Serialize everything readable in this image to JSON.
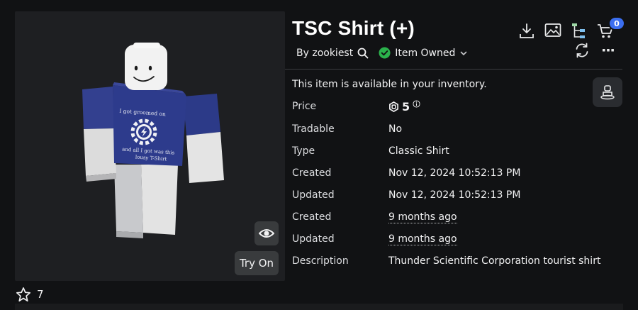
{
  "item": {
    "title": "TSC Shirt (+)",
    "creator": "By zookiest",
    "owned_label": "Item Owned",
    "availability": "This item is available in your inventory."
  },
  "shirt_print": {
    "line1": "I got groomed on",
    "line2": "and all I got was this",
    "line3": "lousy T-Shirt"
  },
  "preview": {
    "try_on_label": "Try On"
  },
  "favorites": {
    "count": "7"
  },
  "header_actions": {
    "cart_count": "0"
  },
  "details": {
    "price": {
      "label": "Price",
      "value": "5"
    },
    "tradable": {
      "label": "Tradable",
      "value": "No"
    },
    "type": {
      "label": "Type",
      "value": "Classic Shirt"
    },
    "created": {
      "label": "Created",
      "value": "Nov 12, 2024 10:52:13 PM"
    },
    "updated": {
      "label": "Updated",
      "value": "Nov 12, 2024 10:52:13 PM"
    },
    "created_rel": {
      "label": "Created",
      "value": "9 months ago"
    },
    "updated_rel": {
      "label": "Updated",
      "value": "9 months ago"
    },
    "description": {
      "label": "Description",
      "value": "Thunder Scientific Corporation tourist shirt"
    }
  },
  "colors": {
    "background": "#111214",
    "panel": "#1e1f22",
    "shirt_blue": "#2c3a88",
    "owned_green": "#2bb24c",
    "badge_blue": "#3b6ef0"
  },
  "icons": {
    "search": "search-icon",
    "owned": "check-circle-icon",
    "chevron": "chevron-down-icon",
    "download": "download-icon",
    "image": "image-icon",
    "hierarchy": "hierarchy-icon",
    "cart": "cart-icon",
    "refresh": "refresh-icon",
    "more": "more-icon",
    "eye": "eye-icon",
    "star": "star-icon",
    "robux": "robux-icon",
    "info": "info-icon",
    "avatar": "avatar-icon"
  }
}
